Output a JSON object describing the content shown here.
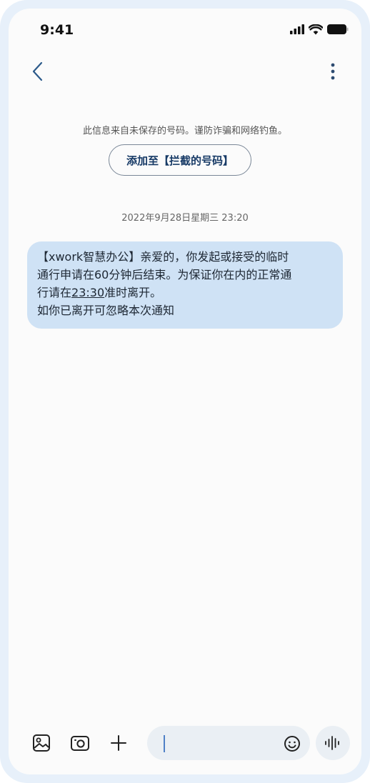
{
  "status_bar": {
    "time": "9:41"
  },
  "conversation": {
    "warning": "此信息来自未保存的号码。谨防诈骗和网络钓鱼。",
    "block_button_label": "添加至【拦截的号码】",
    "timestamp": "2022年9月28日星期三 23:20",
    "message": {
      "line1": "【xwork智慧办公】亲爱的，你发起或接受的临时",
      "line2": "通行申请在60分钟后结束。为保证你在内的正常通",
      "line3_prefix": "行请在",
      "line3_time": "23:30",
      "line3_suffix": "准时离开。",
      "line4": "如你已离开可忽略本次通知"
    }
  },
  "composer": {
    "placeholder": "",
    "value": ""
  },
  "icons": {
    "back": "chevron-left-icon",
    "more": "more-vertical-icon",
    "gallery": "image-icon",
    "camera": "camera-icon",
    "add": "plus-icon",
    "emoji": "smiley-icon",
    "voice": "waveform-icon",
    "signal": "signal-icon",
    "wifi": "wifi-icon",
    "battery": "battery-icon"
  },
  "colors": {
    "bubble": "#cfe2f5",
    "frame": "#e7f0fa",
    "accent": "#173a66",
    "cursor": "#4f80c7"
  }
}
